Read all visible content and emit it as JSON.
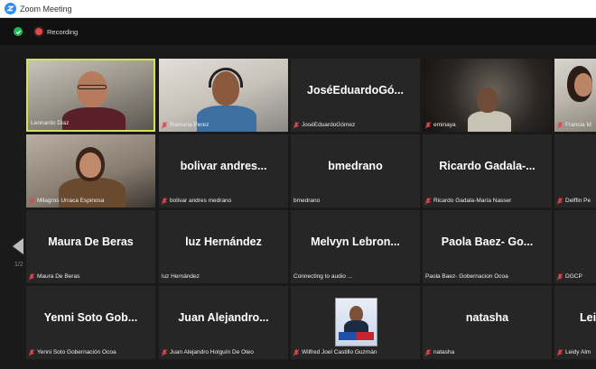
{
  "window": {
    "title": "Zoom Meeting"
  },
  "topbar": {
    "recording_label": "Recording"
  },
  "pager": {
    "label": "1/2"
  },
  "colors": {
    "active_border": "#d4e157",
    "recording": "#e0464b",
    "secure": "#1db954",
    "zoom_blue": "#2d8cff"
  },
  "tiles": [
    {
      "display": "",
      "label": "Leonardo Diaz",
      "muted": false,
      "video": true
    },
    {
      "display": "",
      "label": "Ramona Perez",
      "muted": true,
      "video": true
    },
    {
      "display": "JoséEduardoGó...",
      "label": "JoséEduardoGómez",
      "muted": true,
      "video": false
    },
    {
      "display": "",
      "label": "eminaya",
      "muted": true,
      "video": true
    },
    {
      "display": "",
      "label": "Francia M",
      "muted": true,
      "video": true
    },
    {
      "display": "",
      "label": "Milagros Urraca Espinosa",
      "muted": true,
      "video": true
    },
    {
      "display": "bolivar andres...",
      "label": "bolivar andres medrano",
      "muted": true,
      "video": false
    },
    {
      "display": "bmedrano",
      "label": "bmedrano",
      "muted": false,
      "video": false
    },
    {
      "display": "Ricardo Gadala-...",
      "label": "Ricardo Gadala-María Nasser",
      "muted": true,
      "video": false
    },
    {
      "display": "",
      "label": "Delffin Pe",
      "muted": true,
      "video": false
    },
    {
      "display": "Maura De Beras",
      "label": "Maura De Beras",
      "muted": true,
      "video": false
    },
    {
      "display": "luz Hernández",
      "label": "luz Hernández",
      "muted": false,
      "video": false
    },
    {
      "display": "Melvyn Lebron...",
      "label": "Connecting to audio ...",
      "muted": false,
      "video": false
    },
    {
      "display": "Paola Baez- Go...",
      "label": "Paola Baez- Gobernacion Ocoa",
      "muted": false,
      "video": false
    },
    {
      "display": "",
      "label": "DGCP",
      "muted": true,
      "video": false
    },
    {
      "display": "Yenni Soto Gob...",
      "label": "Yenni Soto Gobernación Ocoa",
      "muted": true,
      "video": false
    },
    {
      "display": "Juan Alejandro...",
      "label": "Juan Alejandro Holguín De Oleo",
      "muted": true,
      "video": false
    },
    {
      "display": "",
      "label": "Wilfred Joel Castillo Guzmán",
      "muted": true,
      "video": false
    },
    {
      "display": "natasha",
      "label": "natasha",
      "muted": true,
      "video": false
    },
    {
      "display": "Lei",
      "label": "Leidy Alm",
      "muted": true,
      "video": false
    }
  ]
}
